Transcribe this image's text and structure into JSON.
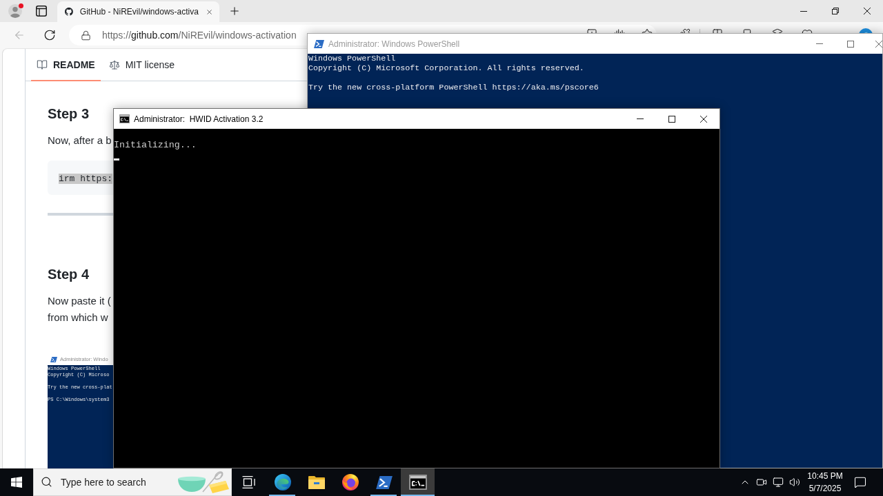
{
  "browser": {
    "profile": {
      "notification": true
    },
    "tabs": [
      {
        "title": "GitHub - NiREvil/windows-activa",
        "selected": true
      }
    ],
    "back_button": {
      "disabled": true
    },
    "address_bar": {
      "scheme": "https://",
      "host": "github.com",
      "path": "/NiREvil/windows-activation"
    },
    "readme": {
      "tabs": [
        {
          "label": "README",
          "selected": true
        },
        {
          "label": "MIT license",
          "selected": false
        }
      ],
      "sections": [
        {
          "heading": "Step 3",
          "paragraph_lines": [
            "Now, after a b"
          ],
          "code": {
            "text": "irm https:",
            "selected": true
          },
          "rule": true
        },
        {
          "heading": "Step 4",
          "paragraph_lines": [
            "Now paste it (",
            "from which w"
          ],
          "screenshot": {
            "title": "Administrator: Windo",
            "blocks": [
              [
                "Windows PowerShell",
                "Copyright (C) Microso"
              ],
              [
                "Try the new cross-plat"
              ],
              [
                "PS C:\\Windows\\system3"
              ]
            ]
          }
        }
      ]
    }
  },
  "powershell_window": {
    "title": "Administrator: Windows PowerShell",
    "active": false,
    "blocks": [
      [
        "Windows PowerShell",
        "Copyright (C) Microsoft Corporation. All rights reserved."
      ],
      [
        "Try the new cross-platform PowerShell https://aka.ms/pscore6"
      ]
    ]
  },
  "hwid_window": {
    "title": "Administrator:  HWID Activation 3.2",
    "active": true,
    "lines": [
      "Initializing..."
    ],
    "cursor": true
  },
  "taskbar": {
    "search": {
      "placeholder": "Type here to search"
    },
    "apps": [
      {
        "kind": "task_view",
        "running": false,
        "active": false
      },
      {
        "kind": "edge",
        "running": true,
        "active": false
      },
      {
        "kind": "explorer",
        "running": false,
        "active": false
      },
      {
        "kind": "firefox",
        "running": false,
        "active": false
      },
      {
        "kind": "powershell",
        "running": true,
        "active": false
      },
      {
        "kind": "cmd",
        "running": true,
        "active": true
      }
    ],
    "clock": {
      "time": "10:45 PM",
      "date": "5/7/2025"
    }
  }
}
